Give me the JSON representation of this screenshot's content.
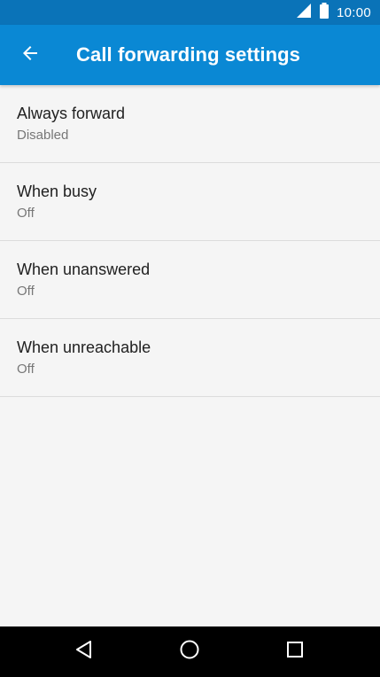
{
  "status_bar": {
    "time": "10:00",
    "icons": [
      "signal-icon",
      "battery-icon"
    ]
  },
  "app_bar": {
    "title": "Call forwarding settings",
    "back_icon": "back-arrow-icon"
  },
  "items": [
    {
      "title": "Always forward",
      "subtitle": "Disabled"
    },
    {
      "title": "When busy",
      "subtitle": "Off"
    },
    {
      "title": "When unanswered",
      "subtitle": "Off"
    },
    {
      "title": "When unreachable",
      "subtitle": "Off"
    }
  ],
  "nav_bar": {
    "buttons": [
      "back-nav-icon",
      "home-nav-icon",
      "recents-nav-icon"
    ]
  },
  "colors": {
    "status_bar": "#0a73b8",
    "app_bar": "#0a88d4",
    "background": "#f5f5f5",
    "nav_bar": "#000000"
  }
}
